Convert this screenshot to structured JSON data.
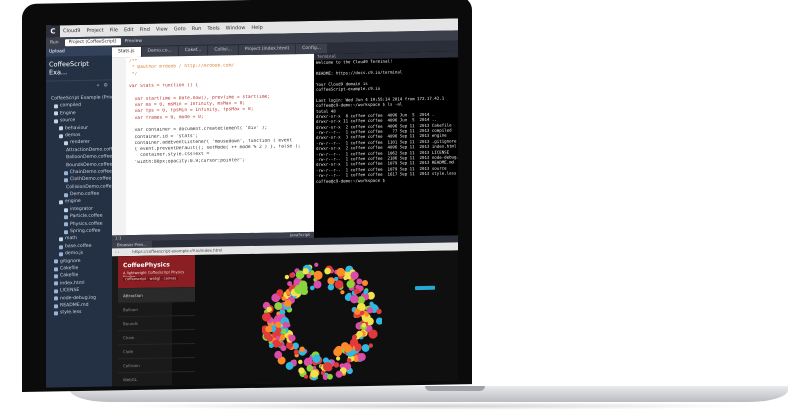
{
  "menubar": {
    "logo": "C",
    "items": [
      "Cloud9",
      "Project",
      "File",
      "Edit",
      "Find",
      "View",
      "Goto",
      "Run",
      "Tools",
      "Window",
      "Help"
    ]
  },
  "toolbar": {
    "run_label": "Run",
    "selector": "Project (CoffeeScript)",
    "preview_label": "Preview"
  },
  "sidebar": {
    "head": "Upload",
    "title": "CoffeeScript Exa...",
    "items": [
      {
        "label": "CoffeeScript Example (Private)",
        "type": "folder",
        "indent": 0
      },
      {
        "label": "compiled",
        "type": "folder",
        "indent": 1
      },
      {
        "label": "Engine",
        "type": "folder",
        "indent": 1
      },
      {
        "label": "source",
        "type": "folder",
        "indent": 1
      },
      {
        "label": "behaviour",
        "type": "folder",
        "indent": 2
      },
      {
        "label": "demos",
        "type": "folder",
        "indent": 2
      },
      {
        "label": "renderer",
        "type": "folder",
        "indent": 3
      },
      {
        "label": "AttractionDemo.coffee",
        "type": "file",
        "indent": 3
      },
      {
        "label": "BalloonDemo.coffee",
        "type": "file",
        "indent": 3
      },
      {
        "label": "BoundsDemo.coffee",
        "type": "file",
        "indent": 3
      },
      {
        "label": "ChainDemo.coffee",
        "type": "file",
        "indent": 3
      },
      {
        "label": "ClothDemo.coffee",
        "type": "file",
        "indent": 3
      },
      {
        "label": "CollisionDemo.coffee",
        "type": "file",
        "indent": 3
      },
      {
        "label": "Demo.coffee",
        "type": "file",
        "indent": 3
      },
      {
        "label": "engine",
        "type": "folder",
        "indent": 2
      },
      {
        "label": "integrator",
        "type": "folder",
        "indent": 3
      },
      {
        "label": "Particle.coffee",
        "type": "file",
        "indent": 3
      },
      {
        "label": "Physics.coffee",
        "type": "file",
        "indent": 3
      },
      {
        "label": "Spring.coffee",
        "type": "file",
        "indent": 3
      },
      {
        "label": "math",
        "type": "folder",
        "indent": 2
      },
      {
        "label": "base.coffee",
        "type": "file",
        "indent": 2
      },
      {
        "label": "demo.js",
        "type": "file",
        "indent": 2
      },
      {
        "label": "gitignore",
        "type": "file",
        "indent": 1
      },
      {
        "label": "Cakefile",
        "type": "file",
        "indent": 1
      },
      {
        "label": "Cakefile",
        "type": "file",
        "indent": 1
      },
      {
        "label": "index.html",
        "type": "file",
        "indent": 1
      },
      {
        "label": "LICENSE",
        "type": "file",
        "indent": 1
      },
      {
        "label": "node-debug.log",
        "type": "file",
        "indent": 1
      },
      {
        "label": "README.md",
        "type": "file",
        "indent": 1
      },
      {
        "label": "style.less",
        "type": "file",
        "indent": 1
      }
    ]
  },
  "tabs": [
    {
      "label": "Stats.js",
      "active": true
    },
    {
      "label": "Demo.co...",
      "active": false
    },
    {
      "label": "Cakef...",
      "active": false
    },
    {
      "label": "Collisi...",
      "active": false
    },
    {
      "label": "Project (index.html)",
      "active": false
    },
    {
      "label": "Config...",
      "active": false
    }
  ],
  "editor": {
    "lines": [
      {
        "text": "/**",
        "kind": "cm"
      },
      {
        "text": " * @author mrdoob / http://mrdoob.com/",
        "kind": "cm"
      },
      {
        "text": " */",
        "kind": "cm"
      },
      {
        "text": "",
        "kind": ""
      },
      {
        "text": "var Stats = function () {",
        "kind": "kw"
      },
      {
        "text": "",
        "kind": ""
      },
      {
        "text": "  var startTime = Date.now(), prevTime = startTime;",
        "kind": "kw"
      },
      {
        "text": "  var ms = 0, msMin = Infinity, msMax = 0;",
        "kind": "kw"
      },
      {
        "text": "  var fps = 0, fpsMin = Infinity, fpsMax = 0;",
        "kind": "kw"
      },
      {
        "text": "  var frames = 0, mode = 0;",
        "kind": "kw"
      },
      {
        "text": "",
        "kind": ""
      },
      {
        "text": "  var container = document.createElement( 'div' );",
        "kind": ""
      },
      {
        "text": "  container.id = 'stats';",
        "kind": ""
      },
      {
        "text": "  container.addEventListener( 'mousedown', function ( event",
        "kind": ""
      },
      {
        "text": "  { event.preventDefault(); setMode( ++ mode % 2 ) }, false );",
        "kind": ""
      },
      {
        "text": "    container.style.cssText =",
        "kind": ""
      },
      {
        "text": "  'width:80px;opacity:0.9;cursor:pointer';",
        "kind": ""
      }
    ],
    "status_left": "1:1",
    "status_right": "JavaScript"
  },
  "terminal": {
    "head": "Terminal",
    "lines": [
      "Welcome to the Cloud9 Terminal!",
      "",
      "README: https://docs.c9.io/terminal",
      "",
      "Your Cloud9 domain is",
      "coffeeScript-example.c9.io",
      "",
      "Last login: Wed Jun 4 19:55:14 2014 from 172.17.42.1",
      "coffee@c9-demo:~/workspace $ ls -al",
      "total 48",
      "drwxr-xr-x  8 coffee coffee  4096 Jun  5  2014 .",
      "drwxr-xr-x 11 coffee coffee  4096 Jun  5  2014 ..",
      "drwxr-xr-x  2 coffee coffee  4096 Sep 11  2013 Cakefile",
      "-rw-r--r--  1 coffee coffee    77 Sep 11  2013 compiled",
      "drwxr-xr-x  3 coffee coffee  4096 Sep 11  2013 engine",
      "-rw-r--r--  1 coffee coffee  1101 Sep 11  2013 .gitignore",
      "drwxr-xr-x  2 coffee coffee  4096 Sep 11  2013 index.html",
      "-rw-r--r--  1 coffee coffee  1062 Sep 11  2013 LICENSE",
      "-rw-r--r--  1 coffee coffee  2186 Sep 11  2013 node-debug.log",
      "drwxr-xr-x  1 coffee coffee  1079 Sep 11  2013 README.md",
      "-rw-r--r--  1 coffee coffee  1079 Sep 11  2013 source",
      "-rw-r--r--  1 coffee coffee  1617 Sep 11  2013 style.less",
      "coffee@c9-demo:~/workspace $"
    ]
  },
  "preview": {
    "tab_label": "Browser Prev...",
    "url": "https://coffeescript-example.c9.io/index.html",
    "nav_arrows": "‹ ›",
    "header_title": "CoffeePhysics",
    "header_subtitle": "A lightweight CoffeeScript Physics Engine",
    "header_tag": "coffeescript · webgl · canvas",
    "menu_items": [
      {
        "label": "Attraction",
        "active": true
      },
      {
        "label": "Balloon",
        "active": false
      },
      {
        "label": "Bounds",
        "active": false
      },
      {
        "label": "Chain",
        "active": false
      },
      {
        "label": "Cloth",
        "active": false
      },
      {
        "label": "Collision",
        "active": false
      },
      {
        "label": "WebGL",
        "active": false
      }
    ],
    "particle_colors": [
      "#e03a3a",
      "#2fb8e0",
      "#8bd43a",
      "#f0e24a",
      "#d94da8",
      "#ff8a2a"
    ]
  }
}
